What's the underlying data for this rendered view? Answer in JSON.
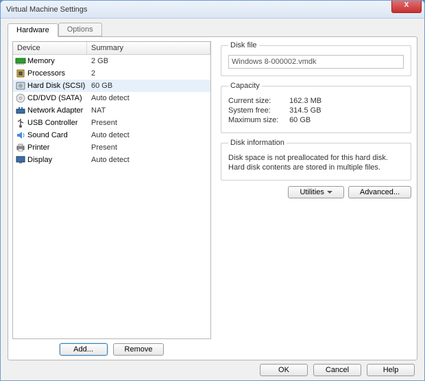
{
  "window": {
    "title": "Virtual Machine Settings",
    "close_x": "X"
  },
  "tabs": {
    "hardware": "Hardware",
    "options": "Options"
  },
  "columns": {
    "device": "Device",
    "summary": "Summary"
  },
  "devices": [
    {
      "icon": "memory",
      "name": "Memory",
      "summary": "2 GB",
      "selected": false
    },
    {
      "icon": "cpu",
      "name": "Processors",
      "summary": "2",
      "selected": false
    },
    {
      "icon": "hdd",
      "name": "Hard Disk (SCSI)",
      "summary": "60 GB",
      "selected": true
    },
    {
      "icon": "cd",
      "name": "CD/DVD (SATA)",
      "summary": "Auto detect",
      "selected": false
    },
    {
      "icon": "net",
      "name": "Network Adapter",
      "summary": "NAT",
      "selected": false
    },
    {
      "icon": "usb",
      "name": "USB Controller",
      "summary": "Present",
      "selected": false
    },
    {
      "icon": "sound",
      "name": "Sound Card",
      "summary": "Auto detect",
      "selected": false
    },
    {
      "icon": "printer",
      "name": "Printer",
      "summary": "Present",
      "selected": false
    },
    {
      "icon": "display",
      "name": "Display",
      "summary": "Auto detect",
      "selected": false
    }
  ],
  "buttons": {
    "add": "Add...",
    "remove": "Remove",
    "utilities": "Utilities",
    "advanced": "Advanced...",
    "ok": "OK",
    "cancel": "Cancel",
    "help": "Help"
  },
  "panel": {
    "disk_file_legend": "Disk file",
    "disk_file_value": "Windows 8-000002.vmdk",
    "capacity_legend": "Capacity",
    "current_size_label": "Current size:",
    "current_size_value": "162.3 MB",
    "system_free_label": "System free:",
    "system_free_value": "314.5 GB",
    "max_size_label": "Maximum size:",
    "max_size_value": "60 GB",
    "disk_info_legend": "Disk information",
    "info_line1": "Disk space is not preallocated for this hard disk.",
    "info_line2": "Hard disk contents are stored in multiple files."
  }
}
